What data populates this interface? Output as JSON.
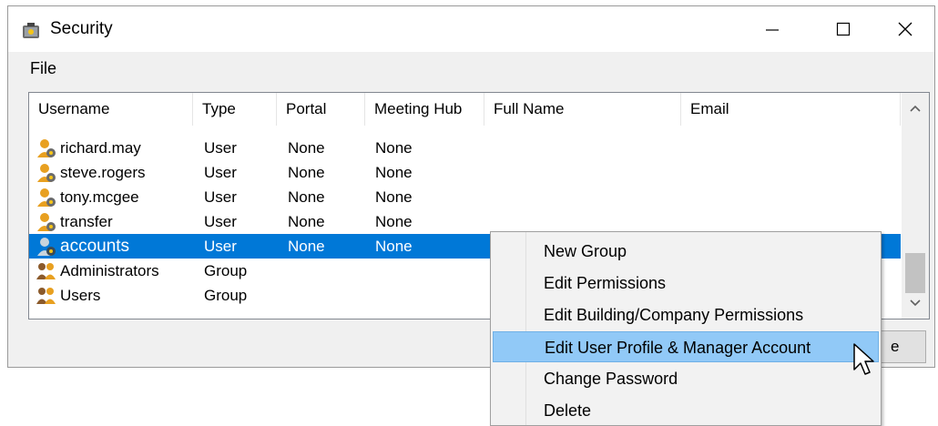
{
  "window": {
    "title": "Security"
  },
  "menu": {
    "file": "File"
  },
  "table": {
    "columns": [
      "Username",
      "Type",
      "Portal",
      "Meeting Hub",
      "Full Name",
      "Email"
    ],
    "rows": [
      {
        "username": "richard.may",
        "type": "User",
        "portal": "None",
        "meeting_hub": "None",
        "icon": "user-icon"
      },
      {
        "username": "steve.rogers",
        "type": "User",
        "portal": "None",
        "meeting_hub": "None",
        "icon": "user-icon"
      },
      {
        "username": "tony.mcgee",
        "type": "User",
        "portal": "None",
        "meeting_hub": "None",
        "icon": "user-icon"
      },
      {
        "username": "transfer",
        "type": "User",
        "portal": "None",
        "meeting_hub": "None",
        "icon": "user-icon"
      },
      {
        "username": "accounts",
        "type": "User",
        "portal": "None",
        "meeting_hub": "None",
        "icon": "user-icon",
        "selected": true
      },
      {
        "username": "Administrators",
        "type": "Group",
        "portal": "",
        "meeting_hub": "",
        "icon": "group-icon"
      },
      {
        "username": "Users",
        "type": "Group",
        "portal": "",
        "meeting_hub": "",
        "icon": "group-icon"
      }
    ]
  },
  "background_button": {
    "label": "e"
  },
  "context_menu": {
    "items": [
      "New Group",
      "Edit Permissions",
      "Edit Building/Company Permissions",
      "Edit User Profile & Manager Account",
      "Change Password",
      "Delete"
    ],
    "highlighted_index": 3
  },
  "colors": {
    "selection": "#0078d7",
    "menu_highlight": "#91c9f7",
    "user_icon": "#e8a020"
  }
}
